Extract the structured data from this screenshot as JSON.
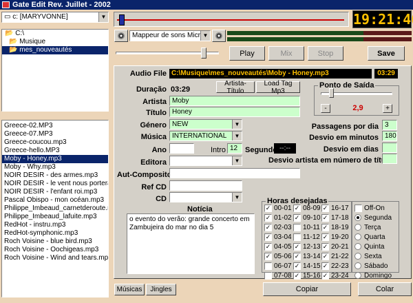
{
  "app": {
    "title": "Gate Edit Rev. Juillet - 2002"
  },
  "drive": {
    "value": "c: [MARYVONNE]"
  },
  "folders": [
    {
      "label": "C:\\"
    },
    {
      "label": "Musique"
    },
    {
      "label": "mes_nouveautés"
    }
  ],
  "files": [
    "Greece-02.MP3",
    "Greece-07.MP3",
    "Greece-coucou.mp3",
    "Greece-hello.MP3",
    "Moby - Honey.mp3",
    "Moby - Why.mp3",
    "NOIR DESIR - des armes.mp3",
    "NOIR DESIR - le vent nous portera.mp3",
    "NOIR DESIR - l'enfant roi.mp3",
    "Pascal Obispo - mon océan.mp3",
    "Philippe_Imbeaud_carnetderoute.mp3",
    "Philippe_Imbeaud_lafuite.mp3",
    "RedHot - instru.mp3",
    "RedHot-symphonic.mp3",
    "Roch Voisine - blue bird.mp3",
    "Roch Voisine - Oochigeas.mp3",
    "Roch Voisine - Wind and tears.mp3"
  ],
  "selected_file_index": 4,
  "clock": {
    "time": "19:21:46"
  },
  "mixer": {
    "value": "Mappeur de sons Microsoft"
  },
  "buttons": {
    "play": "Play",
    "mix": "Mix",
    "stop": "Stop",
    "save": "Save",
    "artist_title": "Artista-Título",
    "load_tag": "Load Tag Mp3",
    "copy": "Copiar",
    "paste": "Colar"
  },
  "audio": {
    "file_label": "Audio File",
    "file_path": "C:\\Musique\\mes_nouveautés\\Moby - Honey.mp3",
    "file_duration": "03:29",
    "duration_label": "Duração",
    "duration_value": "03:29",
    "progress_fraction": 0.01
  },
  "form": {
    "artist_label": "Artista",
    "artist_value": "Moby",
    "title_label": "Título",
    "title_value": "Honey",
    "genre_label": "Género",
    "genre_value": "NEW",
    "music_label": "Música",
    "music_value": "INTERNATIONAL",
    "year_label": "Ano",
    "year_value": "",
    "intro_label": "Intro",
    "intro_value": "12",
    "seconds_label": "Segundos",
    "seconds_value": "--:--",
    "editor_label": "Editora",
    "editor_value": "",
    "composer_label": "Aut-Compositor",
    "composer_value": "",
    "refcd_label": "Ref CD",
    "refcd_value": "",
    "cd_label": "CD",
    "cd_value": ""
  },
  "exit_point": {
    "label": "Ponto de Saída",
    "value": "2,9",
    "minus": "-",
    "plus": "+"
  },
  "stats": {
    "passes_label": "Passagens por dia",
    "passes_value": "3",
    "offset_label": "Desvio em minutos",
    "offset_value": "180",
    "days_label": "Desvio em dias",
    "days_value": "",
    "artist_offset_label": "Desvio artista em número de títulos",
    "artist_offset_value": ""
  },
  "notes": {
    "label": "Notícia",
    "text": "o evento do verão: grande concerto em Zambujeira do mar no dia 5"
  },
  "hours": {
    "label": "Horas desejadas",
    "col1": [
      {
        "h": "00-01",
        "c": true
      },
      {
        "h": "01-02",
        "c": true
      },
      {
        "h": "02-03",
        "c": true
      },
      {
        "h": "03-04",
        "c": true
      },
      {
        "h": "04-05",
        "c": true
      },
      {
        "h": "05-06",
        "c": true
      },
      {
        "h": "06-07",
        "c": false
      },
      {
        "h": "07-08",
        "c": false
      }
    ],
    "col2": [
      {
        "h": "08-09",
        "c": true
      },
      {
        "h": "09-10",
        "c": true
      },
      {
        "h": "10-11",
        "c": false
      },
      {
        "h": "11-12",
        "c": false
      },
      {
        "h": "12-13",
        "c": true
      },
      {
        "h": "13-14",
        "c": true
      },
      {
        "h": "14-15",
        "c": true
      },
      {
        "h": "15-16",
        "c": true
      }
    ],
    "col3": [
      {
        "h": "16-17",
        "c": true
      },
      {
        "h": "17-18",
        "c": true
      },
      {
        "h": "18-19",
        "c": true
      },
      {
        "h": "19-20",
        "c": true
      },
      {
        "h": "20-21",
        "c": true
      },
      {
        "h": "21-22",
        "c": true
      },
      {
        "h": "22-23",
        "c": true
      },
      {
        "h": "23-24",
        "c": true
      }
    ]
  },
  "days": {
    "offon": "Off-On",
    "items": [
      {
        "d": "Segunda",
        "on": true
      },
      {
        "d": "Terça",
        "on": false
      },
      {
        "d": "Quarta",
        "on": false
      },
      {
        "d": "Quinta",
        "on": false
      },
      {
        "d": "Sexta",
        "on": false
      },
      {
        "d": "Sábado",
        "on": false
      },
      {
        "d": "Domingo",
        "on": false
      }
    ]
  },
  "tabs": {
    "music": "Músicas",
    "jingles": "Jingles"
  },
  "colors": {
    "accent": "#0a246a",
    "field_green": "#ccffcc",
    "clock_digits": "#ffc000",
    "exit_value": "#cc0000"
  }
}
